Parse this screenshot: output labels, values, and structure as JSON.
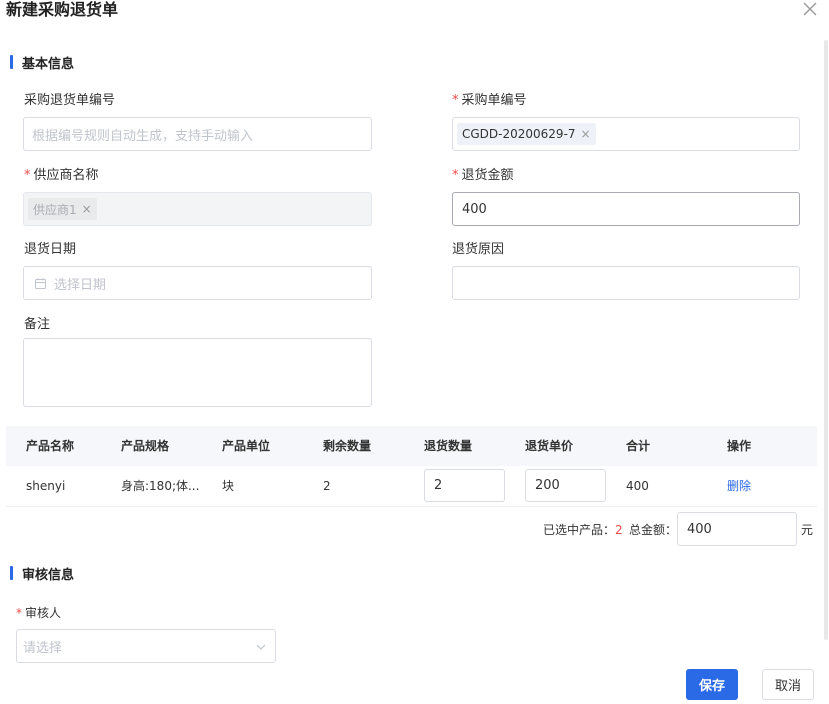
{
  "dialog": {
    "title": "新建采购退货单"
  },
  "basic": {
    "section_title": "基本信息",
    "return_no": {
      "label": "采购退货单编号",
      "placeholder": "根据编号规则自动生成，支持手动输入"
    },
    "purchase_no": {
      "label": "采购单编号",
      "required": "*",
      "tag": "CGDD-20200629-7",
      "tag_x": "×"
    },
    "supplier": {
      "label": "供应商名称",
      "required": "*",
      "tag": "供应商1",
      "tag_x": "×"
    },
    "amount": {
      "label": "退货金额",
      "required": "*",
      "value": "400"
    },
    "date": {
      "label": "退货日期",
      "placeholder": "选择日期"
    },
    "reason": {
      "label": "退货原因",
      "value": ""
    },
    "remark": {
      "label": "备注"
    }
  },
  "table": {
    "headers": [
      "产品名称",
      "产品规格",
      "产品单位",
      "剩余数量",
      "退货数量",
      "退货单价",
      "合计",
      "操作"
    ],
    "rows": [
      {
        "name": "shenyi",
        "spec": "身高:180;体...",
        "unit": "块",
        "remaining": "2",
        "qty": "2",
        "price": "200",
        "total": "400",
        "action": "删除"
      }
    ]
  },
  "summary": {
    "selected_label": "已选中产品：",
    "selected_count": "2",
    "total_label": "总金额：",
    "total_value": "400",
    "currency": "元"
  },
  "review": {
    "section_title": "审核信息",
    "reviewer": {
      "label": "审核人",
      "required": "*",
      "placeholder": "请选择"
    }
  },
  "footer": {
    "save": "保存",
    "cancel": "取消"
  },
  "colors": {
    "primary": "#2b6ae6",
    "required": "#e84a4a"
  }
}
